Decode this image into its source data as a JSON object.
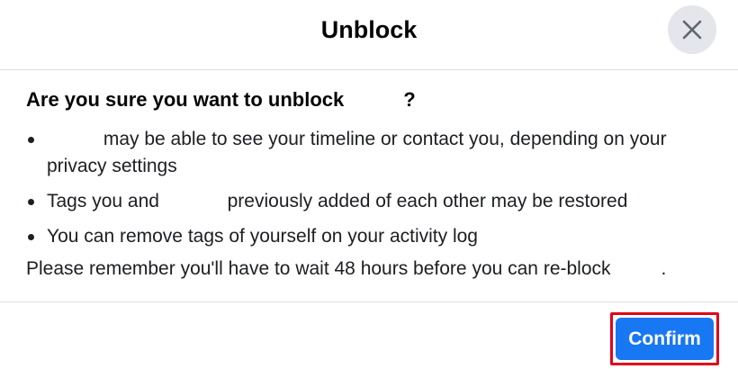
{
  "dialog": {
    "title": "Unblock",
    "close_icon": "close-icon",
    "question_prefix": "Are you sure you want to unblock",
    "question_suffix": "?",
    "points": [
      {
        "before": "",
        "after": "may be able to see your timeline or contact you, depending on your privacy settings"
      },
      {
        "before": "Tags you and",
        "after": "previously added of each other may be restored"
      },
      {
        "before": "You can remove tags of yourself on your activity log",
        "after": ""
      }
    ],
    "reminder_text": "Please remember you'll have to wait 48 hours before you can re-block",
    "reminder_end": ".",
    "confirm_label": "Confirm"
  },
  "colors": {
    "primary_button": "#1877f2",
    "highlight_border": "#e0001b",
    "close_button_bg": "#e4e6eb",
    "divider": "#dadde1"
  }
}
